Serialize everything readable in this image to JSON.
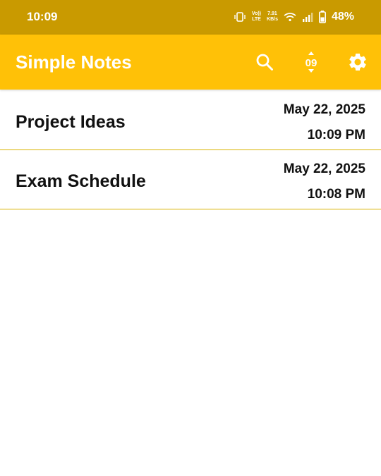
{
  "status_bar": {
    "time": "10:09",
    "volte_top": "Vo))",
    "volte_bottom": "LTE",
    "speed_value": "7.91",
    "speed_unit": "KB/s",
    "battery": "48%",
    "icons": [
      "vibrate-icon",
      "volte-icon",
      "wifi-icon",
      "signal-icon",
      "battery-icon"
    ]
  },
  "app_bar": {
    "title": "Simple Notes",
    "sort_badge": "09",
    "actions": [
      "search-icon",
      "sort-icon",
      "gear-icon"
    ]
  },
  "notes": [
    {
      "title": "Project Ideas",
      "date": "May 22, 2025",
      "time": "10:09 PM"
    },
    {
      "title": "Exam Schedule",
      "date": "May 22, 2025",
      "time": "10:08 PM"
    }
  ],
  "colors": {
    "status_bar": "#C99A00",
    "app_bar": "#FFC107",
    "divider": "#D9B300",
    "text": "#111111"
  }
}
